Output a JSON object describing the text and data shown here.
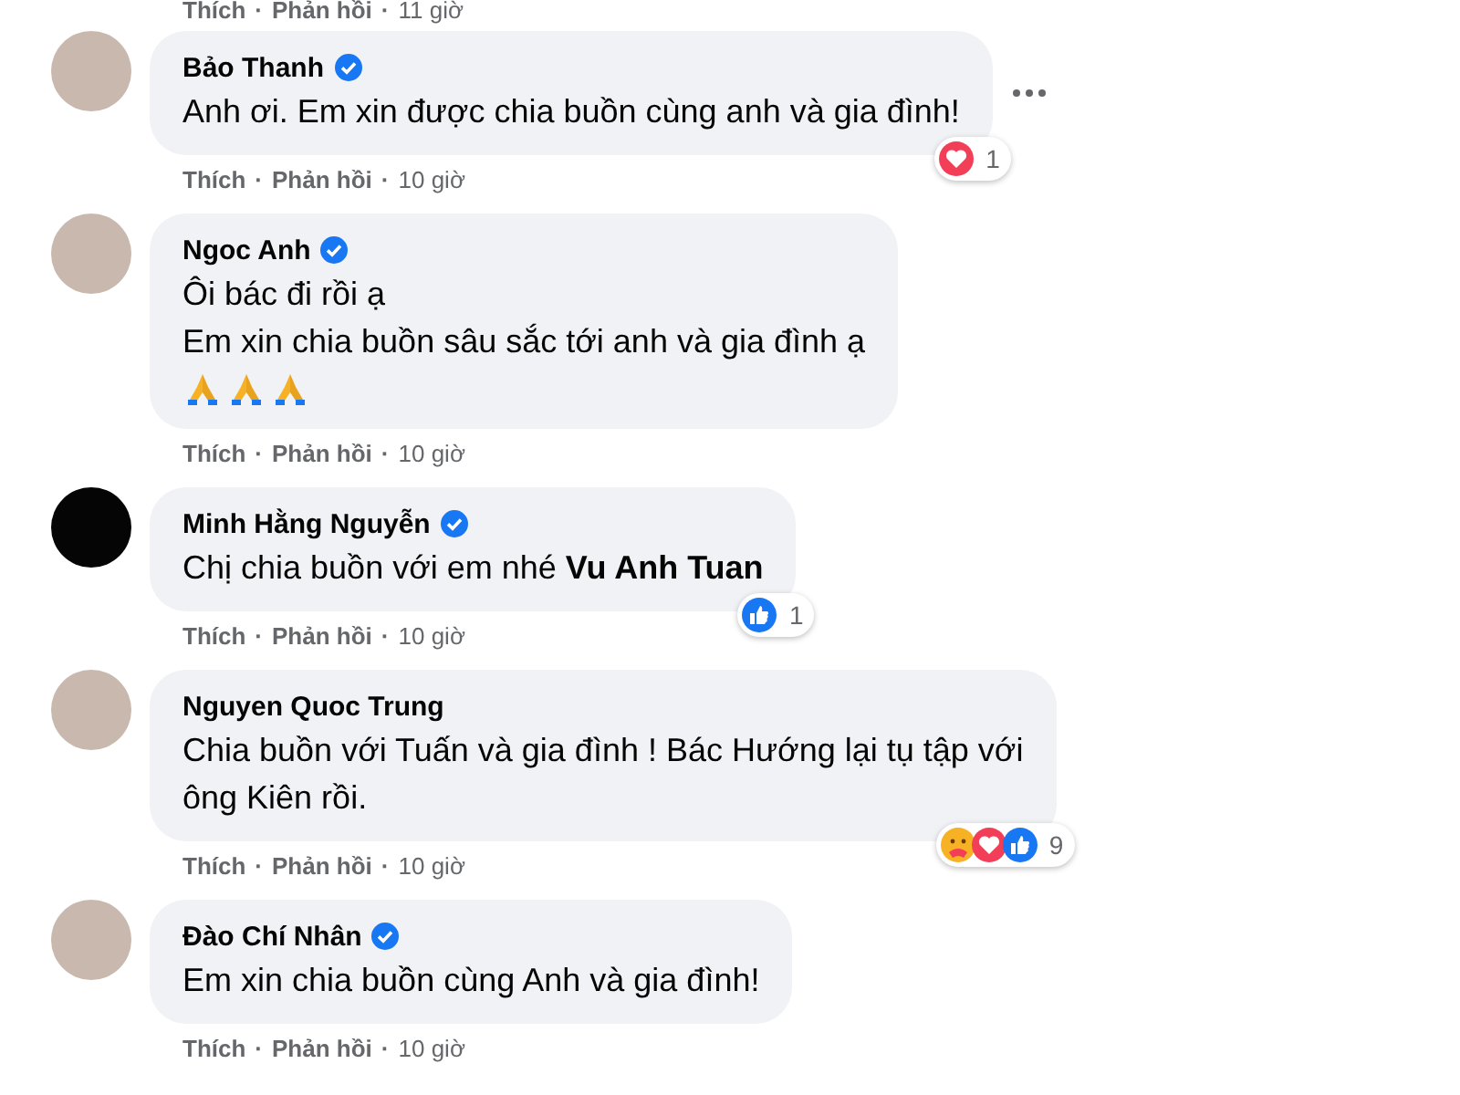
{
  "separator": "·",
  "top_actions": {
    "actions": [
      "Thích",
      "Phản hồi"
    ],
    "time": "11 giờ"
  },
  "comments": [
    {
      "author": "Bảo Thanh",
      "verified": true,
      "avatar": {
        "kind": "photo"
      },
      "lines": [
        "Anh ơi. Em xin được chia buồn cùng anh và gia đình!"
      ],
      "more_menu": true,
      "actions": [
        "Thích",
        "Phản hồi"
      ],
      "time": "10 giờ",
      "reactions": {
        "icons": [
          {
            "kind": "love"
          }
        ],
        "count": "1"
      }
    },
    {
      "author": "Ngoc Anh",
      "verified": true,
      "avatar": {
        "kind": "photo"
      },
      "lines": [
        "Ôi bác đi rồi ạ",
        "Em xin chia buồn sâu sắc tới anh và gia đình ạ"
      ],
      "emojis": [
        {
          "kind": "pray"
        },
        {
          "kind": "pray"
        },
        {
          "kind": "pray"
        }
      ],
      "more_menu": false,
      "actions": [
        "Thích",
        "Phản hồi"
      ],
      "time": "10 giờ"
    },
    {
      "author": "Minh Hằng Nguyễn",
      "verified": true,
      "avatar": {
        "kind": "dark"
      },
      "lines": [
        "Chị chia buồn với em nhé **Vu Anh Tuan**"
      ],
      "more_menu": false,
      "actions": [
        "Thích",
        "Phản hồi"
      ],
      "time": "10 giờ",
      "reactions": {
        "icons": [
          {
            "kind": "like"
          }
        ],
        "count": "1"
      }
    },
    {
      "author": "Nguyen Quoc Trung",
      "verified": false,
      "avatar": {
        "kind": "photo"
      },
      "lines": [
        "Chia buồn với Tuấn và gia đình ! Bác Hướng lại tụ tập với",
        "ông Kiên rồi."
      ],
      "more_menu": false,
      "actions": [
        "Thích",
        "Phản hồi"
      ],
      "time": "10 giờ",
      "reactions": {
        "icons": [
          {
            "kind": "care"
          },
          {
            "kind": "love"
          },
          {
            "kind": "like"
          }
        ],
        "count": "9"
      }
    },
    {
      "author": "Đào Chí Nhân",
      "verified": true,
      "avatar": {
        "kind": "photo"
      },
      "lines": [
        "Em xin chia buồn cùng Anh và gia đình!"
      ],
      "more_menu": false,
      "actions": [
        "Thích",
        "Phản hồi"
      ],
      "time": "10 giờ"
    }
  ]
}
